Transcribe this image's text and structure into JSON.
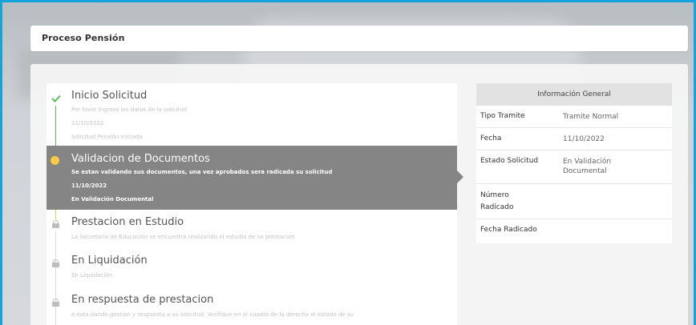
{
  "header": {
    "title": "Proceso Pensión"
  },
  "timeline": {
    "steps": [
      {
        "title": "Inicio Solicitud",
        "description": "Por favor ingrese los datos de la solicitud",
        "date": "11/10/2022",
        "status": "Solicitud Pensión Iniciada",
        "icon": "check-icon"
      },
      {
        "title": "Validacion de Documentos",
        "description": "Se estan validando sus documentos, una vez aprobados sera radicada su solicitud",
        "date": "11/10/2022",
        "status": "En Validación Documental",
        "icon": "current-step-dot-icon"
      },
      {
        "title": "Prestacion en Estudio",
        "description": "La Secretaria de Educacion se encuentra realizando el estudio de su prestacion",
        "icon": "lock-icon"
      },
      {
        "title": "En Liquidación",
        "description": "En Liquidación",
        "icon": "lock-icon"
      },
      {
        "title": "En respuesta de prestacion",
        "description": "e esta dando gestion y respuesta a su solicitud. Verifique en el cuadro de la derecha el estado de su",
        "icon": "lock-icon"
      }
    ]
  },
  "info": {
    "heading": "Información General",
    "rows": [
      {
        "label": "Tipo Tramite",
        "value": "Tramite Normal"
      },
      {
        "label": "Fecha",
        "value": "11/10/2022"
      },
      {
        "label": "Estado Solicitud",
        "value": "En Validación Documental"
      },
      {
        "label": "Número Radicado",
        "value": ""
      },
      {
        "label": "Fecha Radicado",
        "value": ""
      }
    ]
  },
  "colors": {
    "frame_border": "#16a3dc",
    "active_step_bg": "#858585",
    "completed_check": "#5cb85c",
    "current_dot": "#f7c948",
    "locked_icon": "#bdbdbd"
  }
}
